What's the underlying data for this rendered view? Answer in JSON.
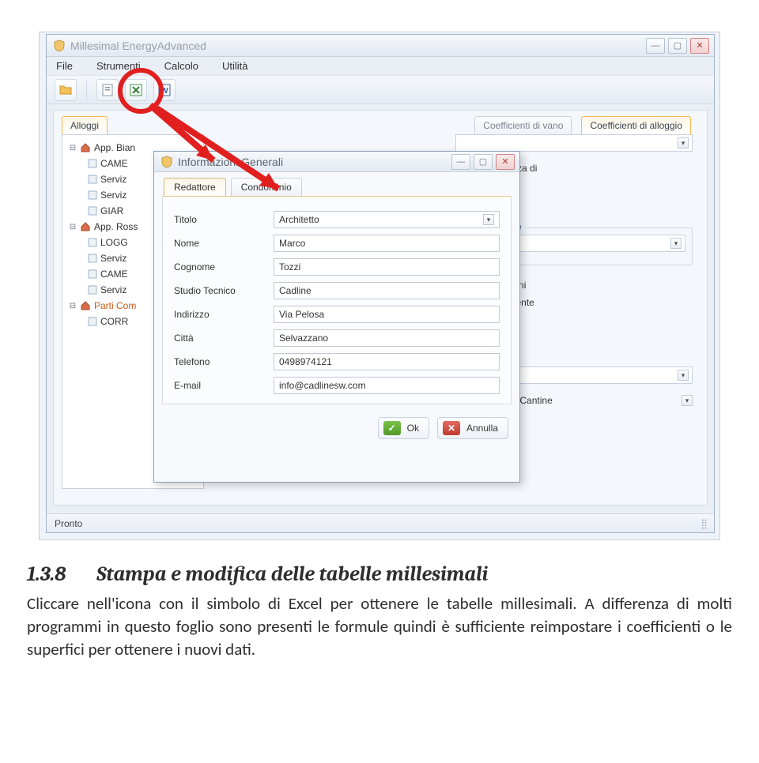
{
  "app": {
    "title": "Millesimal EnergyAdvanced",
    "menu": {
      "file": "File",
      "strumenti": "Strumenti",
      "calcolo": "Calcolo",
      "utilita": "Utilità"
    },
    "status": "Pronto"
  },
  "tabs": {
    "left": "Alloggi",
    "right_cut": "Coefficienti di vano",
    "right_active": "Coefficienti di alloggio"
  },
  "tree": {
    "r1": "App. Bian",
    "r1c": [
      "CAME",
      "Serviz",
      "Serviz",
      "GIAR"
    ],
    "r2": "App. Ross",
    "r2c": [
      "LOGG",
      "Serviz",
      "CAME",
      "Serviz"
    ],
    "r3": "Parti Com",
    "r3c": [
      "CORR"
    ]
  },
  "right": {
    "text1": "primo in assenza di",
    "group2": "nalità globale",
    "combo2": "a",
    "text2a": "alloggi e dei vani",
    "text2b": "pettati. Coefficente",
    "combo3_label": "e",
    "chk": "Box Auto e Cantine"
  },
  "dialog": {
    "title": "Informazioni Generali",
    "tab1": "Redattore",
    "tab2": "Condominio",
    "fields": {
      "titolo_label": "Titolo",
      "titolo_value": "Architetto",
      "nome_label": "Nome",
      "nome_value": "Marco",
      "cognome_label": "Cognome",
      "cognome_value": "Tozzi",
      "studio_label": "Studio Tecnico",
      "studio_value": "Cadline",
      "indirizzo_label": "Indirizzo",
      "indirizzo_value": "Via Pelosa",
      "citta_label": "Città",
      "citta_value": "Selvazzano",
      "telefono_label": "Telefono",
      "telefono_value": "0498974121",
      "email_label": "E-mail",
      "email_value": "info@cadlinesw.com"
    },
    "ok": "Ok",
    "cancel": "Annulla"
  },
  "doc": {
    "heading_num": "1.3.8",
    "heading_text": "Stampa e modifica delle tabelle millesimali",
    "para": "Cliccare nell'icona con il simbolo di Excel per ottenere le tabelle millesimali. A differenza di molti programmi in questo foglio sono presenti le formule quindi è sufficiente reimpostare i coefficienti o le superfici per ottenere i nuovi dati."
  }
}
